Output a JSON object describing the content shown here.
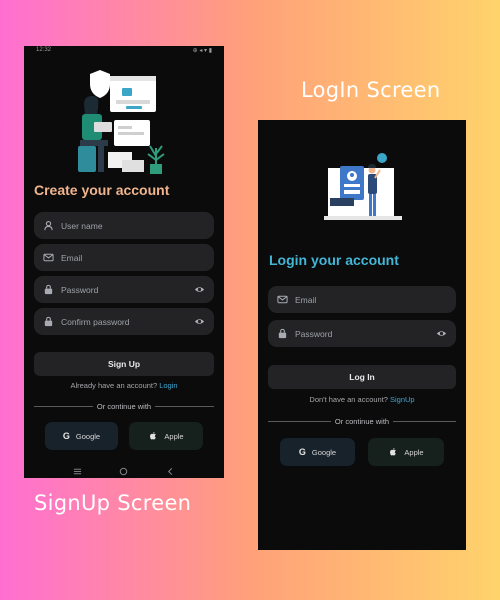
{
  "captions": {
    "login": "LogIn Screen",
    "signup": "SignUp Screen"
  },
  "signup": {
    "status": {
      "time": "12:32",
      "right": "⊕ ◂ ▾ ▮"
    },
    "title": "Create your account",
    "fields": [
      {
        "icon": "user-icon",
        "placeholder": "User name"
      },
      {
        "icon": "mail-icon",
        "placeholder": "Email"
      },
      {
        "icon": "lock-icon",
        "placeholder": "Password",
        "eye": true
      },
      {
        "icon": "lock-icon",
        "placeholder": "Confirm password",
        "eye": true
      }
    ],
    "button": "Sign Up",
    "account_prompt": "Already have an account?",
    "account_link": "Login",
    "divider": "Or continue with",
    "google": "Google",
    "apple": "Apple",
    "google_letter": "G"
  },
  "login": {
    "title": "Login your account",
    "fields": [
      {
        "icon": "mail-icon",
        "placeholder": "Email"
      },
      {
        "icon": "lock-icon",
        "placeholder": "Password",
        "eye": true
      }
    ],
    "button": "Log In",
    "account_prompt": "Don't have an account?",
    "account_link": "SignUp",
    "divider": "Or continue with",
    "google": "Google",
    "apple": "Apple",
    "google_letter": "G"
  },
  "colors": {
    "signup_title": "#f0b58d",
    "login_title": "#43b6d6",
    "link": "#3fa7cf",
    "field_bg": "#232326",
    "phone_bg": "#0b0b0c"
  }
}
